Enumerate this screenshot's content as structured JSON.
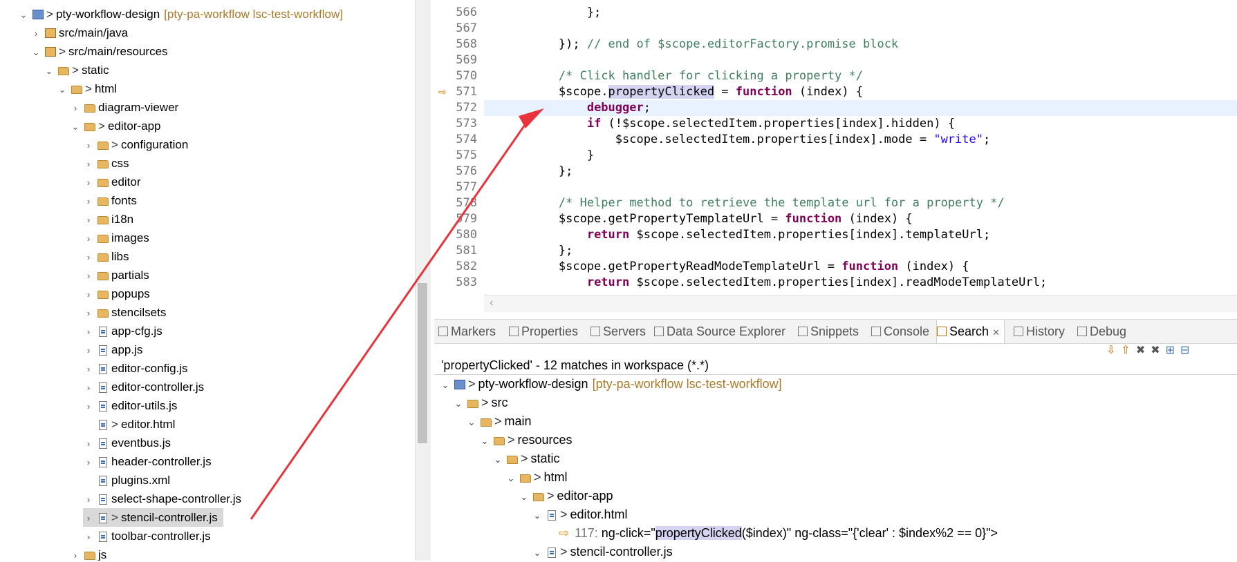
{
  "explorer": {
    "rows": [
      {
        "label": "pty-workflow-design",
        "decor": "[pty-pa-workflow lsc-test-workflow]",
        "prefix": ">"
      },
      {
        "label": "src/main/java"
      },
      {
        "label": "src/main/resources",
        "prefix": ">"
      },
      {
        "label": "static",
        "prefix": ">"
      },
      {
        "label": "html",
        "prefix": ">"
      },
      {
        "label": "diagram-viewer"
      },
      {
        "label": "editor-app",
        "prefix": ">"
      },
      {
        "label": "configuration",
        "prefix": ">"
      },
      {
        "label": "css"
      },
      {
        "label": "editor"
      },
      {
        "label": "fonts"
      },
      {
        "label": "i18n"
      },
      {
        "label": "images"
      },
      {
        "label": "libs"
      },
      {
        "label": "partials"
      },
      {
        "label": "popups"
      },
      {
        "label": "stencilsets"
      },
      {
        "label": "app-cfg.js"
      },
      {
        "label": "app.js"
      },
      {
        "label": "editor-config.js"
      },
      {
        "label": "editor-controller.js"
      },
      {
        "label": "editor-utils.js"
      },
      {
        "label": "editor.html",
        "prefix": ">"
      },
      {
        "label": "eventbus.js"
      },
      {
        "label": "header-controller.js"
      },
      {
        "label": "plugins.xml"
      },
      {
        "label": "select-shape-controller.js"
      },
      {
        "label": "stencil-controller.js",
        "prefix": ">"
      },
      {
        "label": "toolbar-controller.js"
      },
      {
        "label": "js"
      }
    ]
  },
  "editor": {
    "lines": [
      {
        "n": "566",
        "code": "            };"
      },
      {
        "n": "567",
        "code": ""
      },
      {
        "n": "568",
        "code": "        }); ",
        "comment": "// end of $scope.editorFactory.promise block"
      },
      {
        "n": "569",
        "code": ""
      },
      {
        "n": "570",
        "code": "        ",
        "comment": "/* Click handler for clicking a property */"
      },
      {
        "n": "571",
        "pre": "        $scope.",
        "hl": "propertyClicked",
        "post": " = ",
        "kw": "function",
        "rest": " (index) {"
      },
      {
        "n": "572",
        "pre": "            ",
        "kw": "debugger",
        "rest": ";"
      },
      {
        "n": "573",
        "pre": "            ",
        "kw": "if",
        "rest": " (!$scope.selectedItem.properties[index].hidden) {"
      },
      {
        "n": "574",
        "pre": "                $scope.selectedItem.properties[index].mode = ",
        "str": "\"write\"",
        "rest": ";"
      },
      {
        "n": "575",
        "code": "            }"
      },
      {
        "n": "576",
        "code": "        };"
      },
      {
        "n": "577",
        "code": ""
      },
      {
        "n": "578",
        "code": "        ",
        "comment": "/* Helper method to retrieve the template url for a property */"
      },
      {
        "n": "579",
        "pre": "        $scope.getPropertyTemplateUrl = ",
        "kw": "function",
        "rest": " (index) {"
      },
      {
        "n": "580",
        "pre": "            ",
        "kw": "return",
        "rest": " $scope.selectedItem.properties[index].templateUrl;"
      },
      {
        "n": "581",
        "code": "        };"
      },
      {
        "n": "582",
        "pre": "        $scope.getPropertyReadModeTemplateUrl = ",
        "kw": "function",
        "rest": " (index) {"
      },
      {
        "n": "583",
        "pre": "            ",
        "kw": "return",
        "rest": " $scope.selectedItem.properties[index].readModeTemplateUrl;"
      }
    ]
  },
  "views": {
    "tabs": [
      "Markers",
      "Properties",
      "Servers",
      "Data Source Explorer",
      "Snippets",
      "Console",
      "Search",
      "History",
      "Debug"
    ],
    "active_tab": "Search",
    "close_glyph": "✕"
  },
  "search": {
    "summary": "'propertyClicked' - 12 matches in workspace (*.*)",
    "rows": [
      {
        "label": "pty-workflow-design",
        "decor": "[pty-pa-workflow lsc-test-workflow]"
      },
      {
        "label": "src"
      },
      {
        "label": "main"
      },
      {
        "label": "resources"
      },
      {
        "label": "static"
      },
      {
        "label": "html"
      },
      {
        "label": "editor-app"
      },
      {
        "label": "editor.html"
      },
      {
        "num": "117:",
        "pre": " ng-click=\"",
        "hl": "propertyClicked",
        "post": "($index)\" ng-class=\"{'clear' : $index%2 == 0}\">"
      },
      {
        "label": "stencil-controller.js"
      }
    ]
  },
  "colors": {
    "keyword": "#7f0055",
    "comment": "#3f7f5f",
    "string": "#2a00ff",
    "highlight": "#d4d4f2",
    "arrow": "#e8333a"
  },
  "icons": [
    "folder-icon",
    "file-icon",
    "project-icon",
    "package-icon",
    "breakpoint-arrow-icon"
  ]
}
